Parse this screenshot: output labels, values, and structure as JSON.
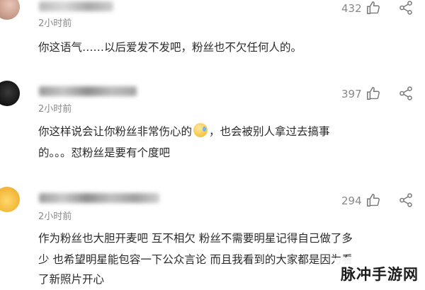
{
  "comments": [
    {
      "time": "2小时前",
      "lines": [
        "你这语气……以后爱发不发吧，粉丝也不欠任何人的。"
      ],
      "likes": "432"
    },
    {
      "time": "2小时前",
      "line1_a": "你这样说会让你粉丝非常伤心的",
      "emoji": "crying-face-emoji",
      "line1_b": "，也会被别人拿过去搞事",
      "line2": "的。。。怼粉丝是要有个度吧",
      "likes": "397"
    },
    {
      "time": "2小时前",
      "lines": [
        "作为粉丝也大胆开麦吧  互不相欠  粉丝不需要明星记得自己做了多",
        "少  也希望明星能包容一下公众言论  而且我看到的大家都是因为看",
        "了新照片开心"
      ],
      "likes": "294"
    }
  ],
  "icons": {
    "like": "thumbs-up-icon",
    "share": "share-icon"
  },
  "watermark": "脉冲手游网",
  "colors": {
    "text": "#2a2a2a",
    "meta": "#8a8a8a",
    "icon": "#777777"
  }
}
